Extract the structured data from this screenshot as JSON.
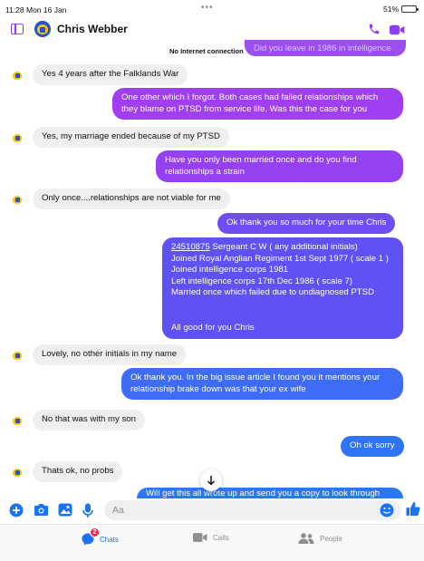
{
  "status_bar": {
    "time": "11:28  Mon 16 Jan",
    "dots": "•••",
    "battery": "51%",
    "battery_level": 0.51
  },
  "header": {
    "contact_name": "Chris Webber",
    "icons": [
      "sidebar-toggle-icon",
      "phone-icon",
      "video-camera-icon"
    ],
    "accent": "#8b3ff5"
  },
  "banner": {
    "text": "No Internet connection",
    "clipped_bubble": "Did you leave in 1986 in intelligence"
  },
  "messages": [
    {
      "dir": "in",
      "text": "Yes 4 years after the Falklands War"
    },
    {
      "dir": "out",
      "text": "One other which I forgot. Both cases had failed relationships which they blame on PTSD from service life. Was this the case for you"
    },
    {
      "dir": "in",
      "text": "Yes, my marriage ended because of my PTSD"
    },
    {
      "dir": "out",
      "text": "Have you only been married once and do you find relationships a strain"
    },
    {
      "dir": "in",
      "text": "Only once....relationships are not viable for me"
    },
    {
      "dir": "out",
      "text": "Ok thank you so much for your time Chris"
    },
    {
      "dir": "out",
      "link": "24510875",
      "lines": [
        " Sergeant C W ( any additional initials)",
        "Joined Royal Anglian Regiment 1st Sept 1977 ( scale 1 )",
        "Joined intelligence corps 1981",
        "Left intelligence corps 17th Dec 1986 ( scale 7)",
        "Married once which failed due to undiagnosed PTSD",
        "All good for you Chris"
      ]
    },
    {
      "dir": "in",
      "text": "Lovely, no other initials in my name"
    },
    {
      "dir": "out",
      "text": "Ok thank you. In the big issue article I found you it mentions your relationship brake down was that your ex wife"
    },
    {
      "dir": "in",
      "text": "No that was with my son"
    },
    {
      "dir": "out",
      "text": "Oh ok sorry"
    },
    {
      "dir": "in",
      "text": "Thats ok, no probs"
    },
    {
      "dir": "out",
      "text": "Will get this all wrote up and send you a copy to look through"
    }
  ],
  "composer": {
    "placeholder": "Aa",
    "icons": [
      "plus-icon",
      "camera-icon",
      "gallery-icon",
      "microphone-icon",
      "emoji-icon",
      "thumbs-up-icon"
    ]
  },
  "tabs": [
    {
      "label": "Chats",
      "icon": "chat-bubble-icon",
      "badge": "2",
      "active": true
    },
    {
      "label": "Calls",
      "icon": "video-icon",
      "active": false
    },
    {
      "label": "People",
      "icon": "people-icon",
      "active": false
    }
  ],
  "colors": {
    "incoming_bubble": "#efefef",
    "outgoing_top": "#9b3ff0",
    "outgoing_bottom": "#2878f7",
    "link_blue": "#1a73f5",
    "badge_red": "#f02849"
  }
}
